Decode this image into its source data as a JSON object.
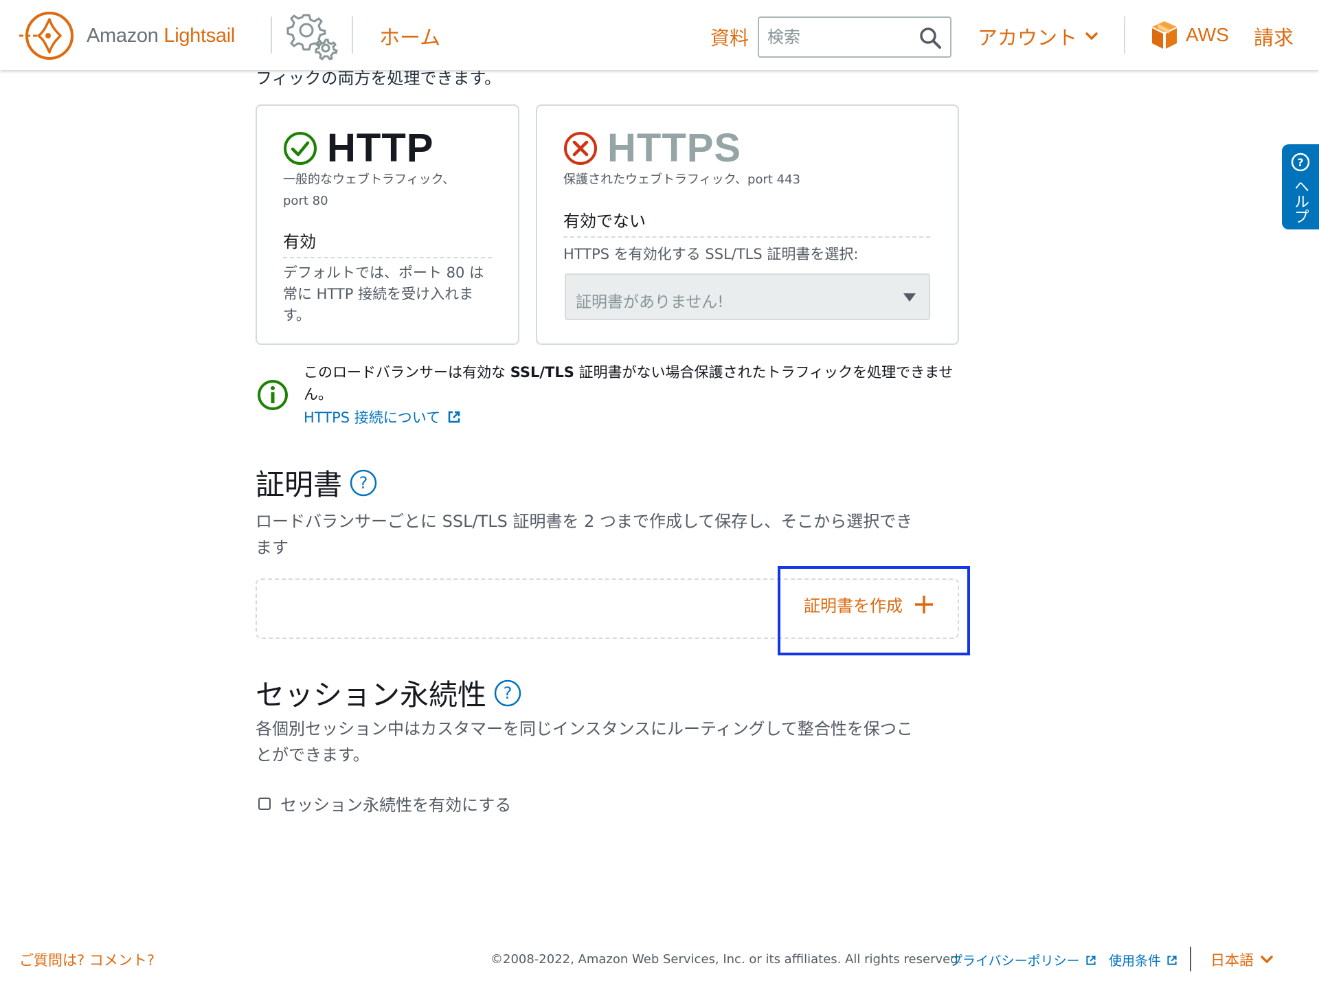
{
  "header": {
    "brand_prefix": "Amazon",
    "brand_name": "Lightsail",
    "home_label": "ホーム",
    "docs_label": "資料",
    "search_placeholder": "検索",
    "account_label": "アカウント",
    "aws_label": "AWS",
    "billing_label": "請求"
  },
  "cut_text": "フィックの両方を処理できます。",
  "http_card": {
    "protocol": "HTTP",
    "subtitle_line1": "一般的なウェブトラフィック、",
    "subtitle_line2": "port 80",
    "state": "有効",
    "description": "デフォルトでは、ポート 80 は常に HTTP 接続を受け入れます。"
  },
  "https_card": {
    "protocol": "HTTPS",
    "subtitle": "保護されたウェブトラフィック、port 443",
    "state": "有効でない",
    "prompt": "HTTPS を有効化する SSL/TLS 証明書を選択:",
    "select_value": "証明書がありません!"
  },
  "info": {
    "text_before": "このロードバランサーは有効な ",
    "text_bold": "SSL/TLS",
    "text_after": " 証明書がない場合保護されたトラフィックを処理できません。",
    "link_label": "HTTPS 接続について"
  },
  "certificates": {
    "title": "証明書",
    "description": "ロードバランサーごとに SSL/TLS 証明書を 2 つまで作成して保存し、そこから選択できます",
    "create_label": "証明書を作成"
  },
  "session": {
    "title": "セッション永続性",
    "description": "各個別セッション中はカスタマーを同じインスタンスにルーティングして整合性を保つことができます。",
    "checkbox_label": "セッション永続性を有効にする",
    "checked": false
  },
  "help_tab": {
    "label": "ヘルプ"
  },
  "footer": {
    "feedback": "ご質問は? コメント?",
    "copyright": "©2008-2022, Amazon Web Services, Inc. or its affiliates. All rights reserved.",
    "privacy": "プライバシーポリシー",
    "terms": "使用条件",
    "language": "日本語"
  },
  "colors": {
    "accent": "#dd6b10",
    "link": "#0073bb",
    "success": "#1d8102",
    "error": "#d13212",
    "highlight": "#1336e6"
  }
}
